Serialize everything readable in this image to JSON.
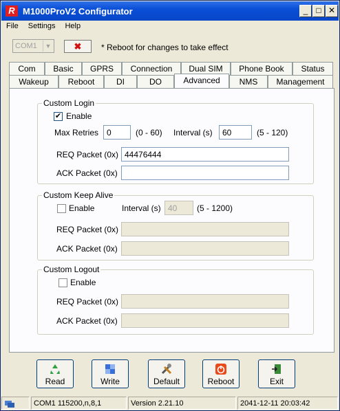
{
  "title": "M1000ProV2 Configurator",
  "title_logo": "R",
  "window_buttons": {
    "minimize": "_",
    "maximize": "□",
    "close": "✕"
  },
  "menu": [
    "File",
    "Settings",
    "Help"
  ],
  "port": {
    "value": "COM1",
    "arrow": "▼"
  },
  "x_button": "✖",
  "reboot_note": "* Reboot for changes to take effect",
  "tabs_top": [
    "Com",
    "Basic",
    "GPRS",
    "Connection",
    "Dual SIM",
    "Phone Book",
    "Status"
  ],
  "tabs_bottom": [
    "Wakeup",
    "Reboot",
    "DI",
    "DO",
    "Advanced",
    "NMS",
    "Management"
  ],
  "active_tab": "Advanced",
  "login": {
    "title": "Custom Login",
    "enable_label": "Enable",
    "enabled": true,
    "check": "✔",
    "max_retries_label": "Max Retries",
    "max_retries": "0",
    "max_retries_range": "(0 - 60)",
    "interval_label": "Interval (s)",
    "interval": "60",
    "interval_range": "(5 - 120)",
    "req_label": "REQ Packet (0x)",
    "req_value": "44476444",
    "ack_label": "ACK Packet (0x)",
    "ack_value": ""
  },
  "keepalive": {
    "title": "Custom Keep Alive",
    "enable_label": "Enable",
    "enabled": false,
    "interval_label": "Interval (s)",
    "interval": "40",
    "interval_range": "(5 - 1200)",
    "req_label": "REQ Packet (0x)",
    "req_value": "",
    "ack_label": "ACK Packet (0x)",
    "ack_value": ""
  },
  "logout": {
    "title": "Custom Logout",
    "enable_label": "Enable",
    "enabled": false,
    "req_label": "REQ Packet (0x)",
    "req_value": "",
    "ack_label": "ACK Packet (0x)",
    "ack_value": ""
  },
  "buttons": {
    "read": "Read",
    "write": "Write",
    "default": "Default",
    "reboot": "Reboot",
    "exit": "Exit"
  },
  "status": {
    "port": "COM1 115200,n,8,1",
    "version": "Version 2.21.10",
    "datetime": "2041-12-11 20:03:42"
  },
  "colors": {
    "title_bar": "#0a4fd6",
    "panel": "#fcfcfe",
    "window": "#ece9d8",
    "logo": "#e02020"
  }
}
